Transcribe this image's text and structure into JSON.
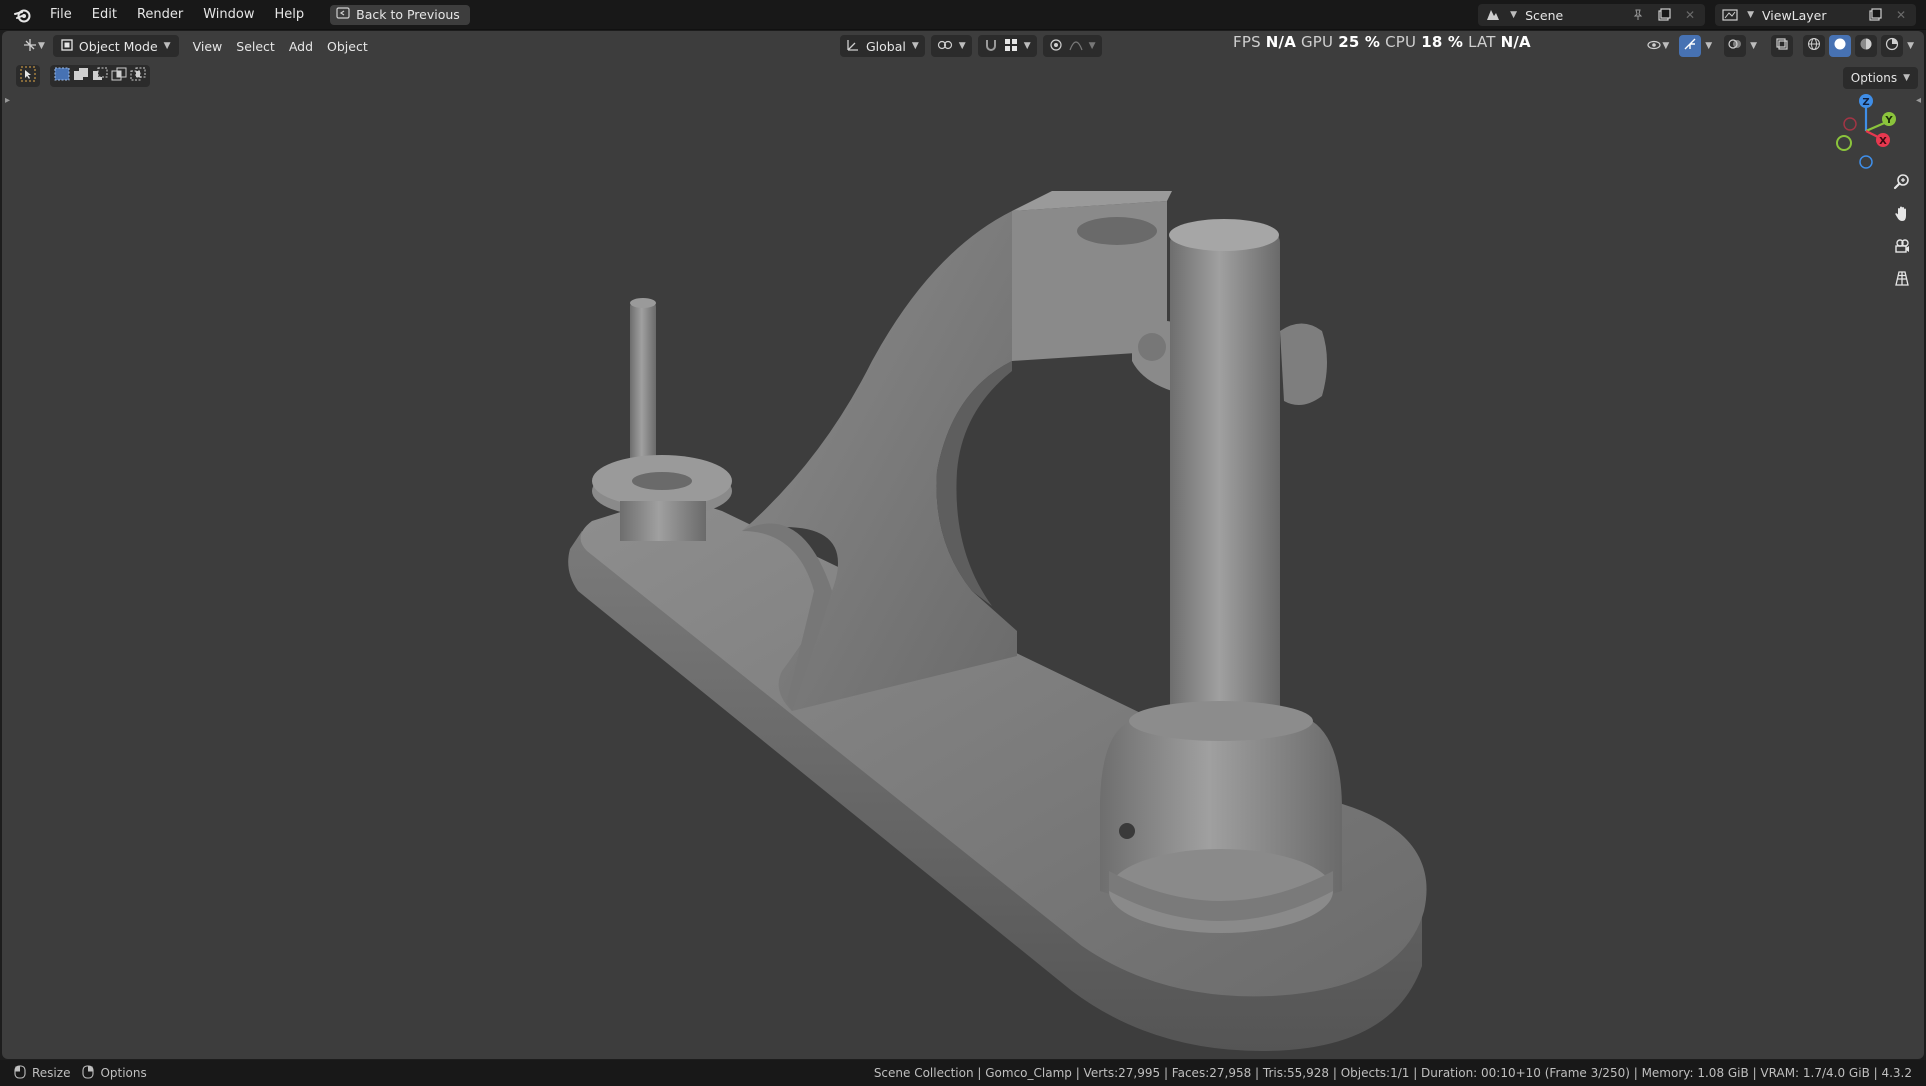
{
  "menubar": {
    "items": [
      "File",
      "Edit",
      "Render",
      "Window",
      "Help"
    ],
    "back_button": "Back to Previous"
  },
  "scene": {
    "label": "Scene",
    "view_layer": "ViewLayer"
  },
  "viewport_header": {
    "mode": "Object Mode",
    "menus": [
      "View",
      "Select",
      "Add",
      "Object"
    ],
    "transform_orientation": "Global",
    "options": "Options"
  },
  "stats": {
    "fps_label": "FPS",
    "fps": "N/A",
    "gpu_label": "GPU",
    "gpu": "25 %",
    "cpu_label": "CPU",
    "cpu": "18 %",
    "lat_label": "LAT",
    "lat": "N/A"
  },
  "gizmo": {
    "z": "Z",
    "y": "Y",
    "x": "X"
  },
  "statusbar": {
    "left": [
      "Resize",
      "Options"
    ],
    "right": "Scene Collection | Gomco_Clamp | Verts:27,995 | Faces:27,958 | Tris:55,928 | Objects:1/1 | Duration: 00:10+10 (Frame 3/250) | Memory: 1.08 GiB | VRAM: 1.7/4.0 GiB | 4.3.2"
  },
  "colors": {
    "accent": "#4772b3",
    "viewport_bg": "#3d3d3d",
    "axis_x": "#e8384f",
    "axis_y": "#8bc43c",
    "axis_z": "#3f8ee8",
    "mode_icon": "#e0a84a"
  },
  "icons": [
    "blender-logo",
    "back-icon",
    "editor-type-icon",
    "object-mode-icon",
    "transform-orientation-icon",
    "pivot-icon",
    "snap-icon",
    "proportional-icon",
    "visibility-icon",
    "gizmo-icon",
    "overlay-icon",
    "xray-icon",
    "shading-wireframe-icon",
    "shading-solid-icon",
    "shading-material-icon",
    "shading-rendered-icon",
    "zoom-icon",
    "pan-icon",
    "camera-icon",
    "grid-icon"
  ]
}
